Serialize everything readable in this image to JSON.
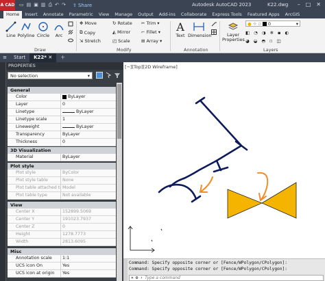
{
  "titlebar": {
    "app_label": "A CAD",
    "share": "Share",
    "title": "Autodesk AutoCAD 2023",
    "file": "K22.dwg"
  },
  "ribbon_tabs": [
    "Home",
    "Insert",
    "Annotate",
    "Parametric",
    "View",
    "Manage",
    "Output",
    "Add-ins",
    "Collaborate",
    "Express Tools",
    "Featured Apps",
    "ArcGIS"
  ],
  "ribbon": {
    "draw": {
      "line": "Line",
      "polyline": "Polyline",
      "circle": "Circle",
      "arc": "Arc",
      "label": "Draw"
    },
    "modify": {
      "move": "Move",
      "rotate": "Rotate",
      "trim": "Trim",
      "copy": "Copy",
      "mirror": "Mirror",
      "fillet": "Fillet",
      "stretch": "Stretch",
      "scale": "Scale",
      "array": "Array",
      "label": "Modify"
    },
    "annotation": {
      "text": "Text",
      "dimension": "Dimension",
      "label": "Annotation"
    },
    "layers": {
      "properties": "Layer Properties",
      "label": "Layers",
      "current_layer": "0"
    }
  },
  "file_tabs": {
    "start": "Start",
    "current": "K22*"
  },
  "properties": {
    "title": "PROPERTIES",
    "selection": "No selection",
    "sections": {
      "general": "General",
      "viz3d": "3D Visualization",
      "plot": "Plot style",
      "view": "View",
      "misc": "Misc"
    },
    "rows": {
      "color": {
        "k": "Color",
        "v": "ByLayer"
      },
      "layer": {
        "k": "Layer",
        "v": "0"
      },
      "linetype": {
        "k": "Linetype",
        "v": "ByLayer"
      },
      "linetype_scale": {
        "k": "Linetype scale",
        "v": "1"
      },
      "lineweight": {
        "k": "Lineweight",
        "v": "ByLayer"
      },
      "transparency": {
        "k": "Transparency",
        "v": "ByLayer"
      },
      "thickness": {
        "k": "Thickness",
        "v": "0"
      },
      "material": {
        "k": "Material",
        "v": "ByLayer"
      },
      "plot_style": {
        "k": "Plot style",
        "v": "ByColor"
      },
      "plot_style_table": {
        "k": "Plot style table",
        "v": "None"
      },
      "plot_table_attached": {
        "k": "Plot table attached to",
        "v": "Model"
      },
      "plot_table_type": {
        "k": "Plot table type",
        "v": "Not available"
      },
      "center_x": {
        "k": "Center X",
        "v": "152899.5069"
      },
      "center_y": {
        "k": "Center Y",
        "v": "191023.7937"
      },
      "center_z": {
        "k": "Center Z",
        "v": "0"
      },
      "height": {
        "k": "Height",
        "v": "1278.7773"
      },
      "width": {
        "k": "Width",
        "v": "2813.6095"
      },
      "annotation_scale": {
        "k": "Annotation scale",
        "v": "1:1"
      },
      "ucs_icon_on": {
        "k": "UCS icon On",
        "v": "Yes"
      },
      "ucs_icon_origin": {
        "k": "UCS icon at origin",
        "v": "Yes"
      }
    }
  },
  "viewport": {
    "label": "[−][Top][2D Wireframe]"
  },
  "command": {
    "line1": "Command: Specify opposite corner or [Fence/WPolygon/CPolygon]:",
    "line2": "Command: Specify opposite corner or [Fence/WPolygon/CPolygon]:",
    "placeholder": "Type a command"
  },
  "colors": {
    "drawing_lines": "#0d1a5c",
    "valve_fill": "#f5b400",
    "arrow": "#f28c28"
  }
}
